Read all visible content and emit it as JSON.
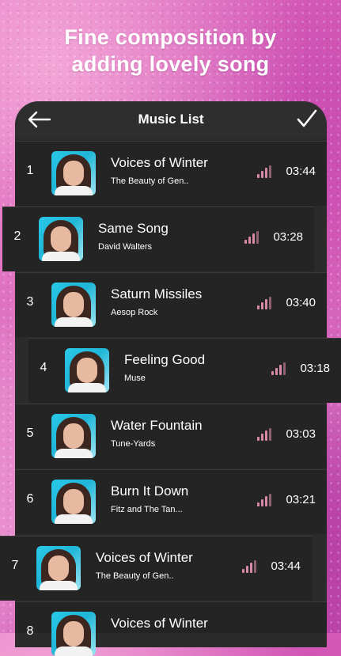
{
  "headline": {
    "line1": "Fine composition by",
    "line2": "adding lovely song"
  },
  "header": {
    "title": "Music List",
    "back_icon": "arrow-left-icon",
    "confirm_icon": "checkmark-icon"
  },
  "accent_color": "#d98aa9",
  "songs": [
    {
      "number": "1",
      "title": "Voices of Winter",
      "artist": "The Beauty of Gen..",
      "duration": "03:44"
    },
    {
      "number": "2",
      "title": "Same Song",
      "artist": "David Walters",
      "duration": "03:28"
    },
    {
      "number": "3",
      "title": "Saturn Missiles",
      "artist": "Aesop Rock",
      "duration": "03:40"
    },
    {
      "number": "4",
      "title": "Feeling Good",
      "artist": "Muse",
      "duration": "03:18"
    },
    {
      "number": "5",
      "title": "Water Fountain",
      "artist": "Tune-Yards",
      "duration": "03:03"
    },
    {
      "number": "6",
      "title": "Burn It Down",
      "artist": "Fitz and The Tan...",
      "duration": "03:21"
    },
    {
      "number": "7",
      "title": "Voices of Winter",
      "artist": "The Beauty of Gen..",
      "duration": "03:44"
    },
    {
      "number": "8",
      "title": "Voices of Winter",
      "artist": "",
      "duration": ""
    }
  ]
}
